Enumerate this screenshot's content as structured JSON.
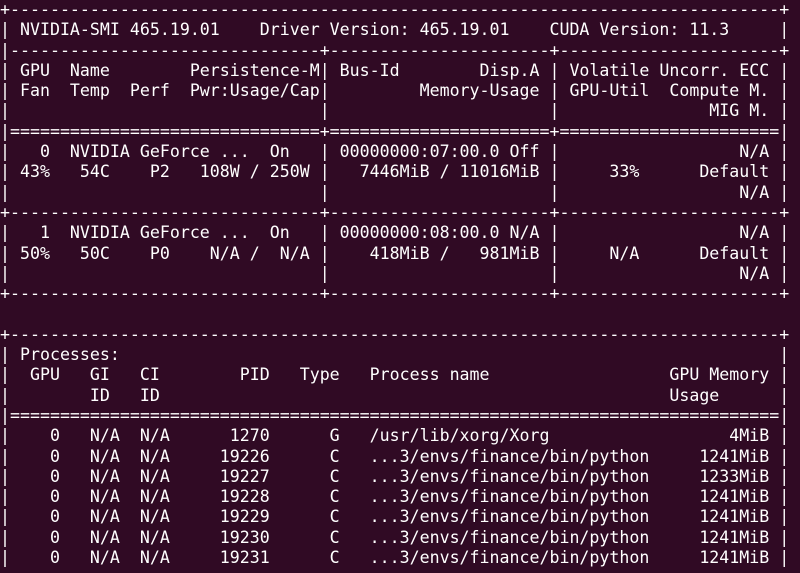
{
  "terminal": {
    "background_color": "#300a24",
    "text_color": "#ffffff",
    "lines": [
      "+-----------------------------------------------------------------------------+",
      "| NVIDIA-SMI 465.19.01    Driver Version: 465.19.01    CUDA Version: 11.3     |",
      "|-------------------------------+----------------------+----------------------+",
      "| GPU  Name        Persistence-M| Bus-Id        Disp.A | Volatile Uncorr. ECC |",
      "| Fan  Temp  Perf  Pwr:Usage/Cap|         Memory-Usage | GPU-Util  Compute M. |",
      "|                               |                      |               MIG M. |",
      "|===============================+======================+======================|",
      "|   0  NVIDIA GeForce ...  On   | 00000000:07:00.0 Off |                  N/A |",
      "| 43%   54C    P2   108W / 250W |   7446MiB / 11016MiB |     33%      Default |",
      "|                               |                      |                  N/A |",
      "+-------------------------------+----------------------+----------------------+",
      "|   1  NVIDIA GeForce ...  On   | 00000000:08:00.0 N/A |                  N/A |",
      "| 50%   50C    P0    N/A /  N/A |    418MiB /   981MiB |     N/A      Default |",
      "|                               |                      |                  N/A |",
      "+-------------------------------+----------------------+----------------------+",
      "",
      "+-----------------------------------------------------------------------------+",
      "| Processes:                                                                  |",
      "|  GPU   GI   CI        PID   Type   Process name                  GPU Memory |",
      "|        ID   ID                                                   Usage      |",
      "|=============================================================================|",
      "|    0   N/A  N/A      1270      G   /usr/lib/xorg/Xorg                  4MiB |",
      "|    0   N/A  N/A     19226      C   ...3/envs/finance/bin/python     1241MiB |",
      "|    0   N/A  N/A     19227      C   ...3/envs/finance/bin/python     1233MiB |",
      "|    0   N/A  N/A     19228      C   ...3/envs/finance/bin/python     1241MiB |",
      "|    0   N/A  N/A     19229      C   ...3/envs/finance/bin/python     1241MiB |",
      "|    0   N/A  N/A     19230      C   ...3/envs/finance/bin/python     1241MiB |",
      "|    0   N/A  N/A     19231      C   ...3/envs/finance/bin/python     1241MiB |",
      "+-----------------------------------------------------------------------------+"
    ]
  }
}
